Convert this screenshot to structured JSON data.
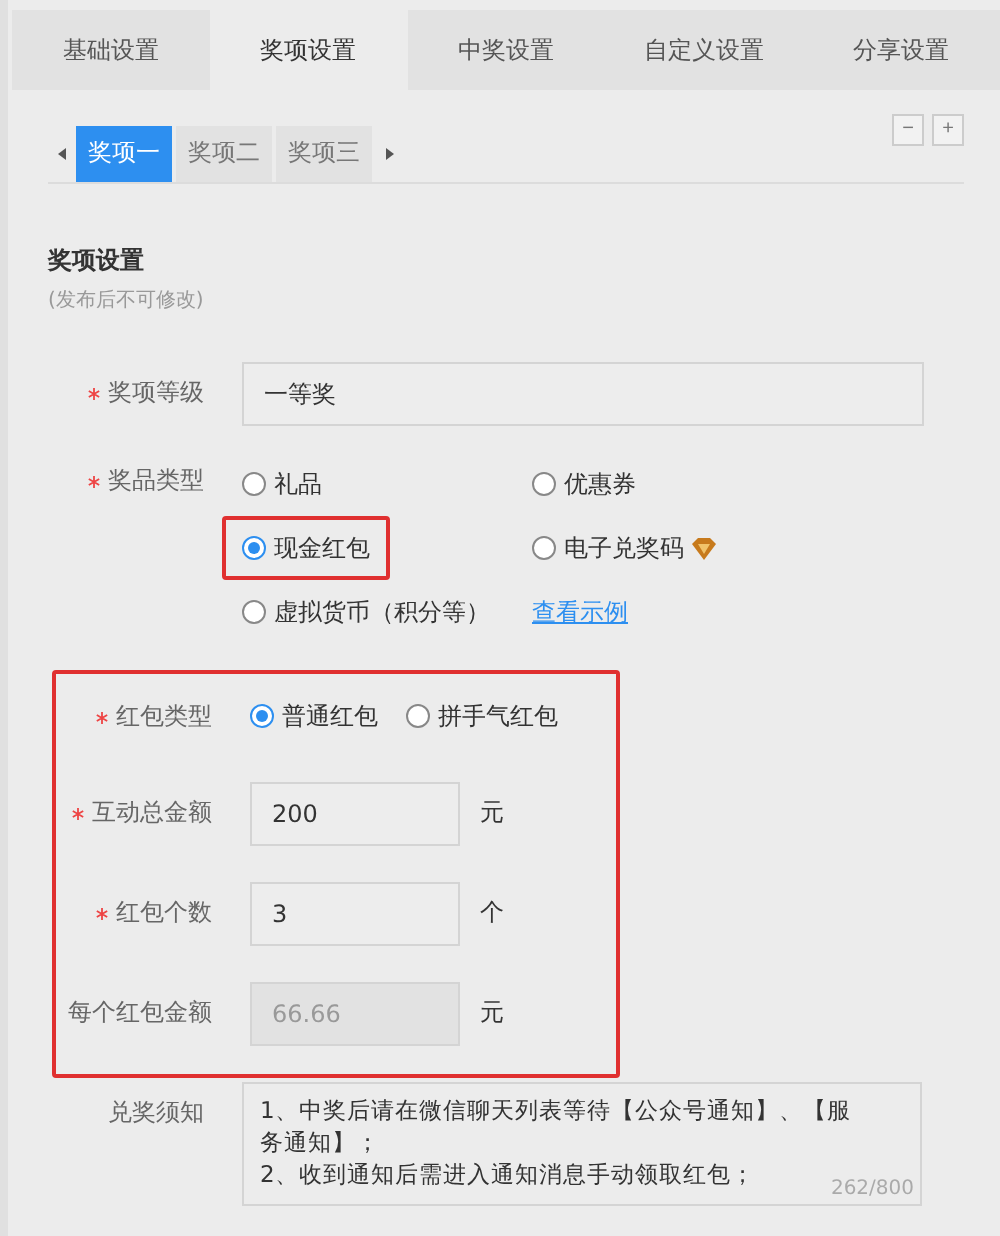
{
  "tabs": [
    {
      "label": "基础设置",
      "selected": false
    },
    {
      "label": "奖项设置",
      "selected": true
    },
    {
      "label": "中奖设置",
      "selected": false
    },
    {
      "label": "自定义设置",
      "selected": false
    },
    {
      "label": "分享设置",
      "selected": false
    }
  ],
  "prize_tabs": [
    {
      "label": "奖项一",
      "selected": true
    },
    {
      "label": "奖项二",
      "selected": false
    },
    {
      "label": "奖项三",
      "selected": false
    }
  ],
  "prize_tab_buttons": [
    "−",
    "+"
  ],
  "section": {
    "title": "奖项设置",
    "subtitle": "(发布后不可修改)"
  },
  "prize_level": {
    "label": "奖项等级",
    "required": true,
    "value": "一等奖"
  },
  "prize_type": {
    "label": "奖品类型",
    "required": true,
    "options": [
      {
        "label": "礼品",
        "selected": false,
        "highlighted": false
      },
      {
        "label": "优惠券",
        "selected": false,
        "highlighted": false
      },
      {
        "label": "现金红包",
        "selected": true,
        "highlighted": true
      },
      {
        "label": "电子兑奖码",
        "selected": false,
        "highlighted": false,
        "premium": true
      },
      {
        "label": "虚拟货币（积分等）",
        "selected": false,
        "highlighted": false
      }
    ],
    "link": "查看示例"
  },
  "red_packet": {
    "highlighted": true,
    "type": {
      "label": "红包类型",
      "required": true,
      "options": [
        {
          "label": "普通红包",
          "selected": true
        },
        {
          "label": "拼手气红包",
          "selected": false
        }
      ]
    },
    "fields": [
      {
        "label": "互动总金额",
        "required": true,
        "value": "200",
        "unit": "元",
        "disabled": false
      },
      {
        "label": "红包个数",
        "required": true,
        "value": "3",
        "unit": "个",
        "disabled": false
      },
      {
        "label": "每个红包金额",
        "required": false,
        "value": "66.66",
        "unit": "元",
        "disabled": true
      }
    ]
  },
  "notice": {
    "label": "兑奖须知",
    "text": "1、中奖后请在微信聊天列表等待【公众号通知】、【服务通知】；\n2、收到通知后需进入通知消息手动领取红包；",
    "count": "262/800"
  }
}
